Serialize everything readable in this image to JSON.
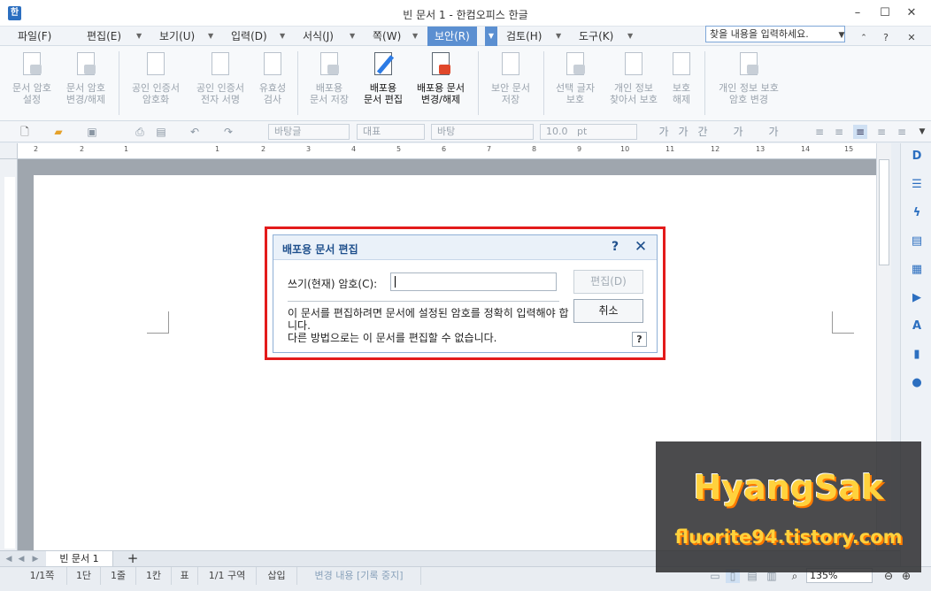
{
  "window": {
    "title": "빈 문서 1 - 한컴오피스 한글",
    "app_icon": "hwp-icon"
  },
  "menu": [
    {
      "label": "파일(F)"
    },
    {
      "label": "편집(E)"
    },
    {
      "label": "보기(U)"
    },
    {
      "label": "입력(D)"
    },
    {
      "label": "서식(J)"
    },
    {
      "label": "쪽(W)"
    },
    {
      "label": "보안(R)"
    },
    {
      "label": "검토(H)"
    },
    {
      "label": "도구(K)"
    }
  ],
  "search": {
    "placeholder": "찾을 내용을 입력하세요."
  },
  "ribbon": [
    {
      "label": "문서 암호\n설정"
    },
    {
      "label": "문서 암호\n변경/해제"
    },
    {
      "label": "공인 인증서\n암호화"
    },
    {
      "label": "공인 인증서\n전자 서명"
    },
    {
      "label": "유효성\n검사"
    },
    {
      "label": "배포용\n문서 저장"
    },
    {
      "label": "배포용\n문서 편집"
    },
    {
      "label": "배포용 문서\n변경/해제"
    },
    {
      "label": "보안 문서\n저장"
    },
    {
      "label": "선택 글자\n보호"
    },
    {
      "label": "개인 정보\n찾아서 보호"
    },
    {
      "label": "보호\n해제"
    },
    {
      "label": "개인 정보 보호\n암호 변경"
    }
  ],
  "toolbar": {
    "style": "바탕글",
    "font_lang": "대표",
    "font": "바탕",
    "size": "10.0",
    "unit": "pt"
  },
  "ruler": {
    "numbers": [
      "2",
      "2",
      "1",
      "1",
      "2",
      "3",
      "4",
      "5",
      "6",
      "7",
      "8",
      "9",
      "10",
      "11",
      "12",
      "13",
      "14",
      "15"
    ]
  },
  "dialog": {
    "title": "배포용 문서 편집",
    "help": "?",
    "close": "✕",
    "password_label": "쓰기(현재) 암호(C):",
    "password_value": "",
    "message": "이 문서를 편집하려면 문서에 설정된 암호를 정확히 입력해야 합니다.\n다른 방법으로는 이 문서를 편집할 수 없습니다.",
    "edit_button": "편집(D)",
    "cancel_button": "취소",
    "help_button": "?"
  },
  "tabs": {
    "doc_tab": "빈 문서 1",
    "add": "+"
  },
  "status": {
    "page": "1/1쪽",
    "column": "1단",
    "line": "1줄",
    "col": "1칸",
    "table": "표",
    "section": "1/1 구역",
    "insert": "삽입",
    "track": "변경 내용 [기록 중지]",
    "zoom": "135%"
  },
  "watermark": {
    "title": "HyangSak",
    "url": "fluorite94.tistory.com"
  }
}
